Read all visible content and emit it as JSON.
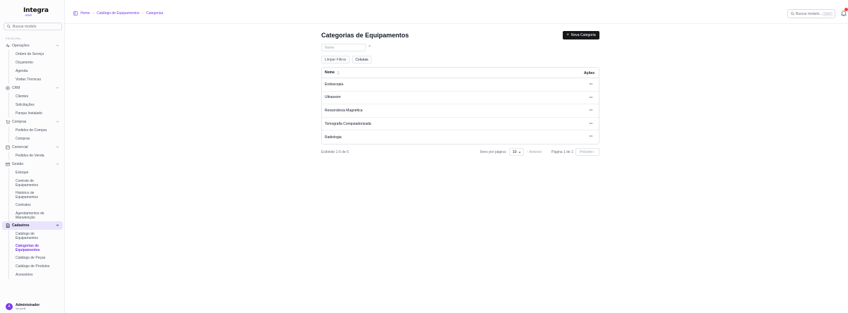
{
  "brand": {
    "name": "Integra",
    "sub": "ERP",
    "accent": "#7c3aed"
  },
  "sidebar": {
    "search_placeholder": "Buscar modulo",
    "section_label": "PRINCIPAL",
    "groups": [
      {
        "label": "Operações",
        "icon": "activity-icon",
        "items": [
          "Ordem de Serviço",
          "Orçamento",
          "Agenda",
          "Visitas Técnicas"
        ]
      },
      {
        "label": "CRM",
        "icon": "target-icon",
        "items": [
          "Clientes",
          "Solicitações",
          "Parque Instalado"
        ]
      },
      {
        "label": "Compras",
        "icon": "cart-icon",
        "items": [
          "Pedidos de Compra",
          "Compras"
        ]
      },
      {
        "label": "Comercial",
        "icon": "store-icon",
        "items": [
          "Pedidos de Venda"
        ]
      },
      {
        "label": "Gestão",
        "icon": "mail-icon",
        "items": [
          "Estoque",
          "Controle de Equipamentos",
          "Histórico de Equipamentos",
          "Contratos",
          "Agendamentos de Manutenção"
        ]
      },
      {
        "label": "Cadastros",
        "icon": "file-icon",
        "items": [
          "Catálogo de Equipamentos",
          "Categorias de Equipamentos",
          "Catálogo de Peças",
          "Catálogo de Produtos",
          "Acessórios"
        ]
      }
    ],
    "user": {
      "initial": "A",
      "name": "Administrador",
      "link": "Ver perfil"
    }
  },
  "topbar": {
    "breadcrumb": [
      "Home",
      "Catálogo de Equipamentos",
      "Categorias"
    ],
    "search_placeholder": "Buscar modulo...",
    "shortcut": "Ctrl+K"
  },
  "main": {
    "title": "Categorias de Equipamentos",
    "new_button": "Nova Categoria",
    "filter_placeholder": "Nome",
    "clear_filters": "Limpar Filtros",
    "columns_button": "Colunas",
    "table": {
      "col_name": "Nome",
      "col_actions": "Ações",
      "rows": [
        "Endoscopia",
        "Ultrassom",
        "Ressonância Magnética",
        "Tomografia Computadorizada",
        "Radiologia"
      ]
    },
    "footer": {
      "showing": "Exibindo 1-5 de 5",
      "per_page_label": "Itens por página:",
      "per_page_value": "10",
      "prev": "Anterior",
      "page_info": "Página 1 de 1",
      "next": "Próximo"
    }
  }
}
